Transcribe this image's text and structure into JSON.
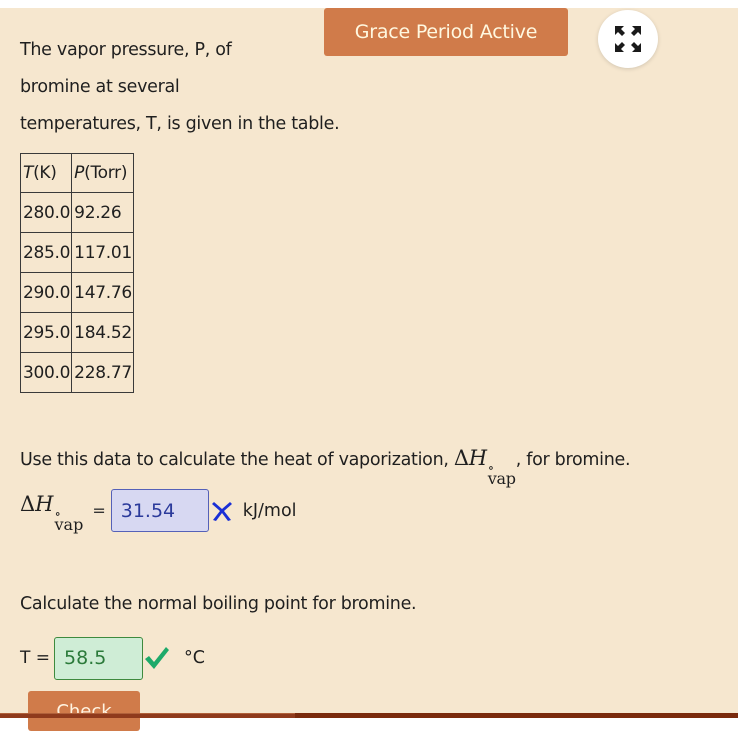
{
  "header": {
    "grace_label": "Grace Period Active",
    "expand_icon": "expand-arrows-icon"
  },
  "intro": {
    "lines": [
      "The vapor pressure, P, of",
      "bromine at several",
      "temperatures, T, is given in the table."
    ]
  },
  "table": {
    "headers": [
      {
        "var": "T",
        "unit": "(K)"
      },
      {
        "var": "P",
        "unit": "(Torr)"
      }
    ],
    "rows": [
      [
        "280.0",
        "92.26"
      ],
      [
        "285.0",
        "117.01"
      ],
      [
        "290.0",
        "147.76"
      ],
      [
        "295.0",
        "184.52"
      ],
      [
        "300.0",
        "228.77"
      ]
    ]
  },
  "question1": {
    "text_before": "Use this data to calculate the heat of vaporization, ",
    "text_after": ", for bromine.",
    "symbol_delta": "Δ",
    "symbol_h": "H",
    "symbol_deg": "∘",
    "symbol_sub": "vap",
    "equals": "=",
    "answer_value": "31.54",
    "status": "incorrect",
    "status_icon": "x-mark-icon",
    "status_color": "#1a2fd6",
    "unit": "kJ/mol"
  },
  "question2": {
    "text": "Calculate the normal boiling point for bromine.",
    "label": "T =",
    "answer_value": "58.5",
    "status": "correct",
    "status_icon": "checkmark-icon",
    "status_color": "#1eaa6a",
    "unit": "°C"
  },
  "footer": {
    "check_label": "Check",
    "progress_fraction": 0.4
  },
  "colors": {
    "background": "#f6e7cf",
    "accent": "#d07b4a",
    "footer_bar": "#7a2a0c"
  }
}
